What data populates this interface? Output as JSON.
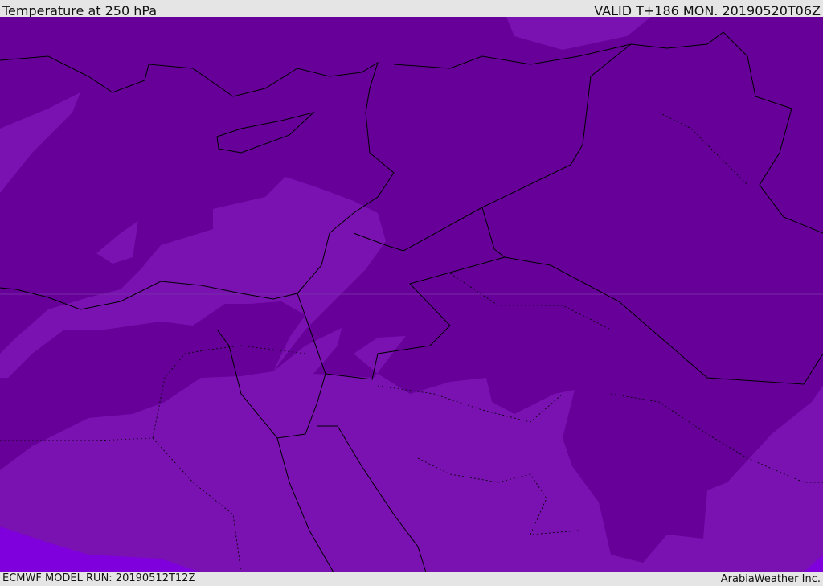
{
  "header": {
    "title": "Temperature at 250 hPa",
    "valid": "VALID T+186 MON. 20190520T06Z"
  },
  "footer": {
    "model_run": "ECMWF MODEL RUN: 20190512T12Z",
    "credit": "ArabiaWeather Inc."
  },
  "colors": {
    "dark_band": "#660099",
    "mid_band": "#7a12b2",
    "bright_band": "#8000dd",
    "border": "#000000"
  }
}
